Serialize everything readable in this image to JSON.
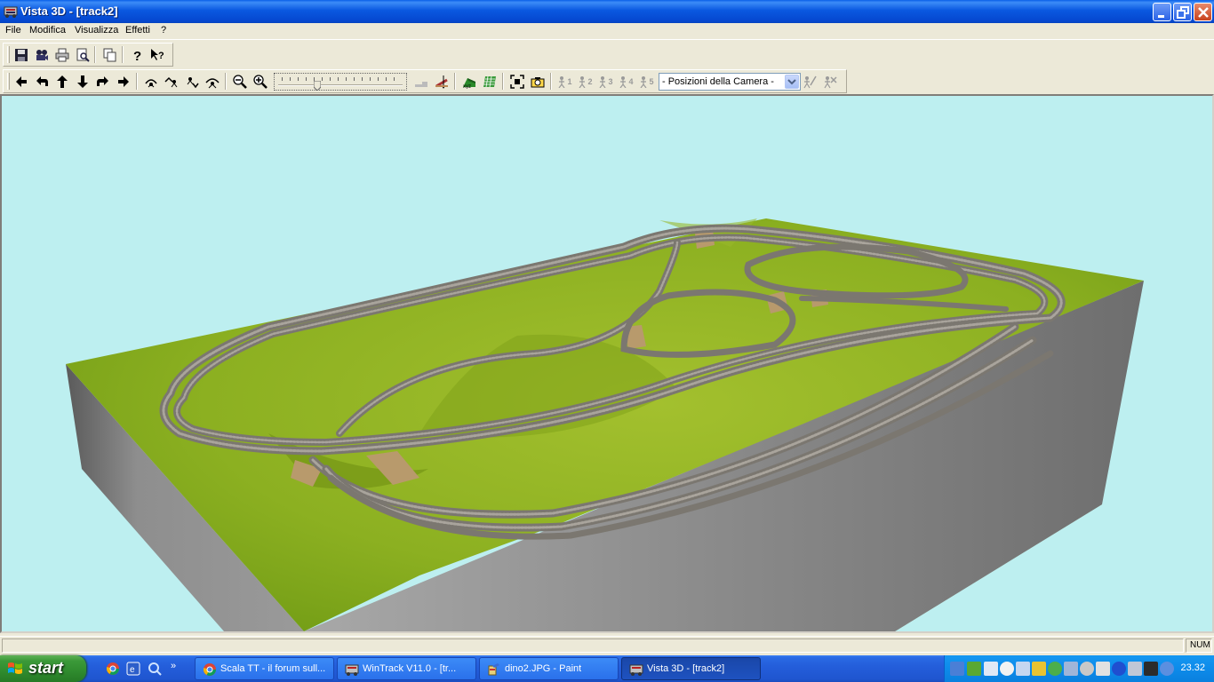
{
  "window": {
    "title": "Vista 3D - [track2]"
  },
  "menu": {
    "items": [
      "File",
      "Modifica",
      "Visualizza",
      "Effetti",
      "?"
    ]
  },
  "toolbar": {
    "camera_select_value": "- Posizioni della Camera -",
    "camera_positions": [
      "1",
      "2",
      "3",
      "4",
      "5"
    ],
    "zoom_slider_level": 0.3
  },
  "status_bar": {
    "message": "",
    "num_indicator": "NUM"
  },
  "taskbar": {
    "start_label": "start",
    "tasks": [
      {
        "label": "Scala TT - il forum sull...",
        "icon": "chrome-icon",
        "active": false
      },
      {
        "label": "WinTrack  V11.0 - [tr...",
        "icon": "wintrack-icon",
        "active": false
      },
      {
        "label": "dino2.JPG - Paint",
        "icon": "paint-icon",
        "active": false
      },
      {
        "label": "Vista 3D - [track2]",
        "icon": "wintrack-icon",
        "active": true
      }
    ],
    "clock": "23.32"
  },
  "colors": {
    "titlebar": "#0a58e0",
    "sky": "#bdeff0",
    "terrain": "#8fb325",
    "board_side": "#8a8a8a",
    "floor": "#a59b7e",
    "track": "#8e8a84"
  }
}
